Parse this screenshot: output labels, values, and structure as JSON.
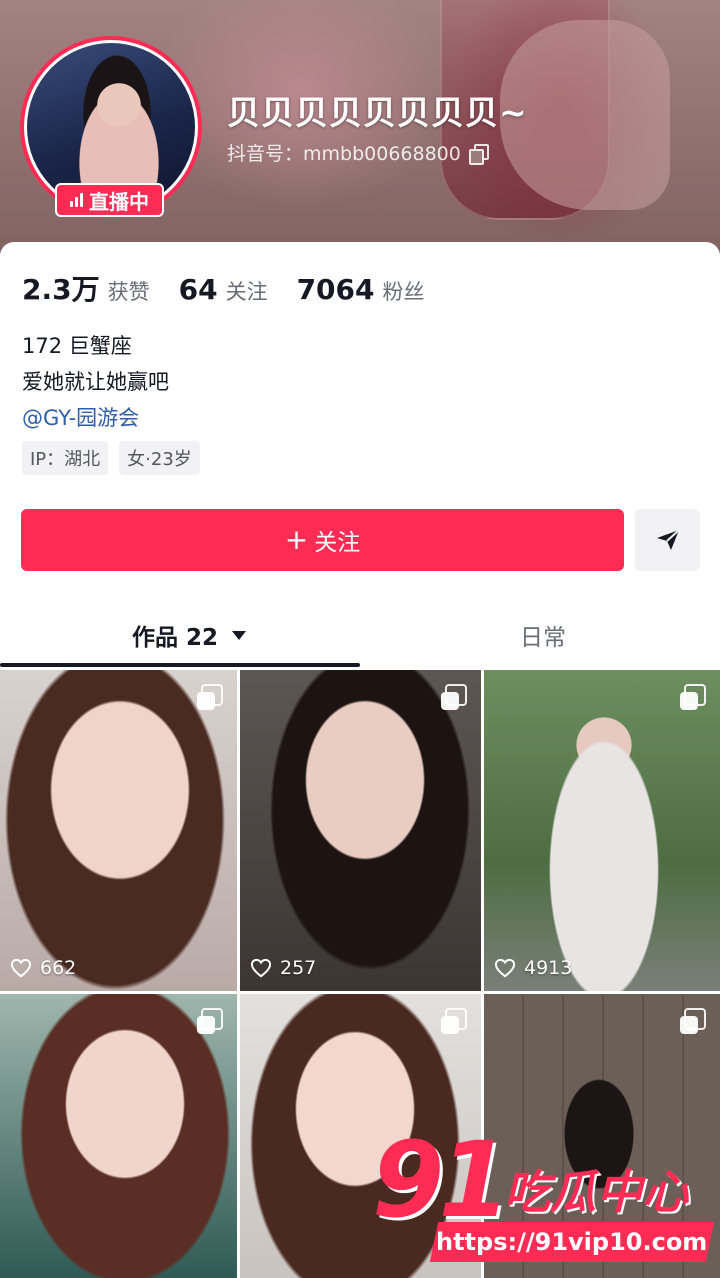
{
  "profile": {
    "nickname": "贝贝贝贝贝贝贝贝~",
    "douyin_id": "抖音号：mmbb00668800",
    "live_label": "直播中",
    "bio_lines": [
      "172 巨蟹座",
      "爱她就让她赢吧"
    ],
    "mention": "@GY-园游会",
    "tags": [
      "IP：湖北",
      "女·23岁"
    ]
  },
  "stats": [
    {
      "value": "2.3万",
      "label": "获赞"
    },
    {
      "value": "64",
      "label": "关注"
    },
    {
      "value": "7064",
      "label": "粉丝"
    }
  ],
  "actions": {
    "follow_label": "关注",
    "follow_prefix": "+"
  },
  "tabs": [
    {
      "label": "作品 22",
      "active": true
    },
    {
      "label": "日常",
      "active": false
    }
  ],
  "posts": [
    {
      "likes": "662"
    },
    {
      "likes": "257"
    },
    {
      "likes": "4913"
    },
    {
      "likes": ""
    },
    {
      "likes": ""
    },
    {
      "likes": ""
    }
  ],
  "watermark": {
    "logo_number": "91",
    "logo_text": "吃瓜中心",
    "url": "https://91vip10.com"
  },
  "colors": {
    "accent": "#fe2c55",
    "mention": "#2f5ea8"
  }
}
